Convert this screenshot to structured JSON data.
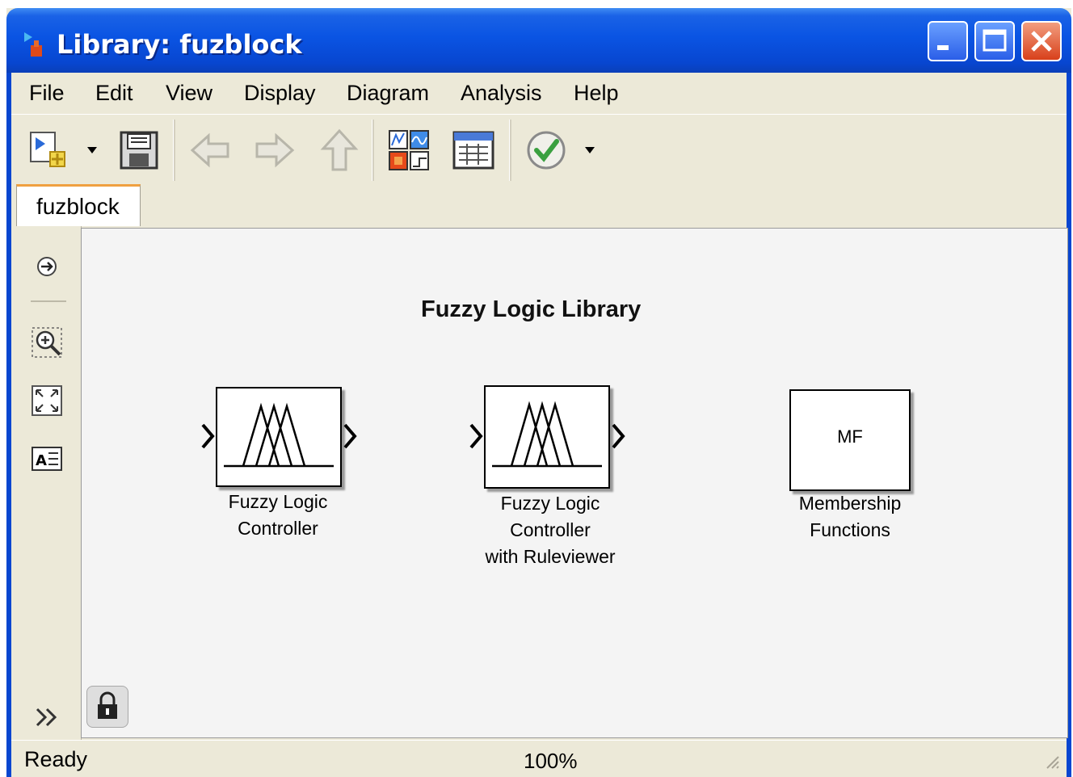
{
  "window": {
    "title": "Library: fuzblock"
  },
  "menu": {
    "items": [
      "File",
      "Edit",
      "View",
      "Display",
      "Diagram",
      "Analysis",
      "Help"
    ]
  },
  "tab": {
    "label": "fuzblock"
  },
  "canvas": {
    "title": "Fuzzy Logic Library",
    "blocks": [
      {
        "label_lines": [
          "Fuzzy Logic",
          "Controller"
        ]
      },
      {
        "label_lines": [
          "Fuzzy Logic",
          "Controller",
          "with Ruleviewer"
        ]
      },
      {
        "label_lines": [
          "Membership",
          "Functions"
        ],
        "icon_text": "MF"
      }
    ]
  },
  "status": {
    "text": "Ready",
    "zoom": "100%"
  },
  "colors": {
    "titlebar": "#0a54e3",
    "chrome": "#ece9d8",
    "canvas": "#f4f4f4",
    "close_button": "#d8401b"
  }
}
